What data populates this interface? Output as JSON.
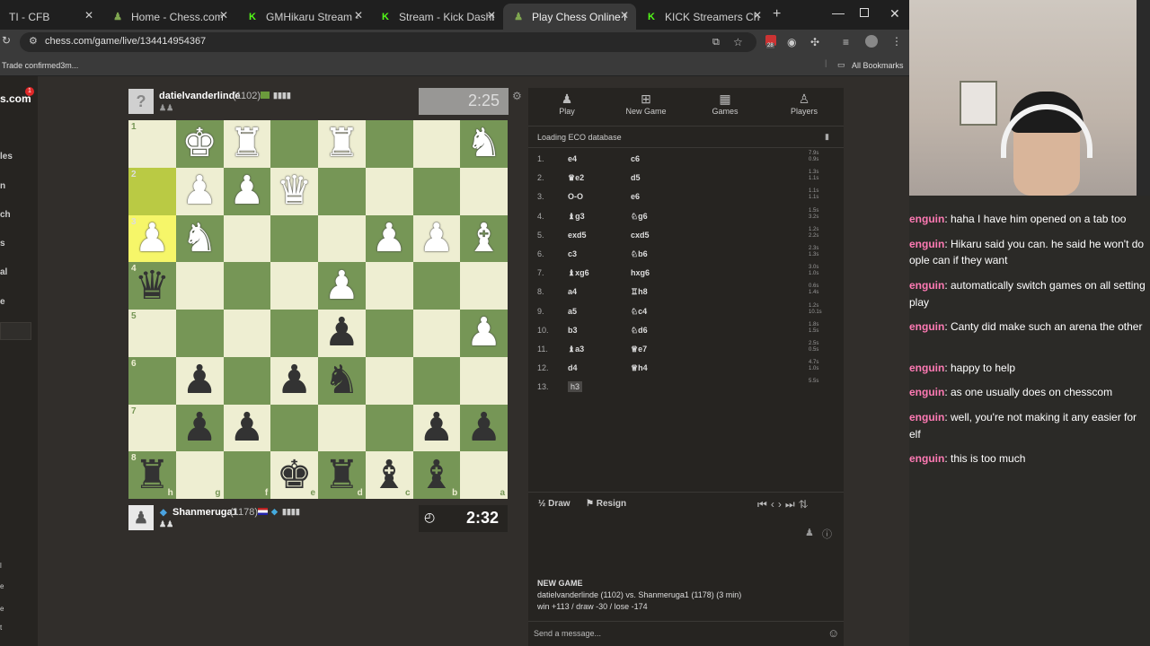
{
  "browser": {
    "tabs": [
      {
        "label": "TI - CFB",
        "icon": "generic-tab-icon"
      },
      {
        "label": "Home - Chess.com",
        "icon": "chess-com-icon"
      },
      {
        "label": "GMHikaru Stream - W",
        "icon": "kick-icon"
      },
      {
        "label": "Stream - Kick Dashboard",
        "icon": "kick-icon"
      },
      {
        "label": "Play Chess Online for",
        "icon": "chess-com-icon"
      },
      {
        "label": "KICK Streamers Chess Wo",
        "icon": "kick-icon"
      }
    ],
    "url": "chess.com/game/live/134414954367",
    "bookmark_left": "Trade confirmed3m...",
    "bookmark_right": "All Bookmarks",
    "extension_badge": "28"
  },
  "left_nav": {
    "logo": "s.com",
    "badge": "1",
    "items": [
      "les",
      "n",
      "ch",
      "s",
      "al",
      "e"
    ],
    "bottom_items": [
      "l",
      "e",
      "e",
      "t"
    ]
  },
  "top_player": {
    "name": "datielvanderlinde",
    "rating": "(1102)",
    "clock": "2:25"
  },
  "bottom_player": {
    "name": "Shanmeruga1",
    "rating": "(1178)",
    "clock": "2:32"
  },
  "board": {
    "ranks": [
      "1",
      "2",
      "3",
      "4",
      "5",
      "6",
      "7",
      "8"
    ],
    "files": [
      "h",
      "g",
      "f",
      "e",
      "d",
      "c",
      "b",
      "a"
    ],
    "rows": [
      [
        "",
        "wK",
        "wR",
        "",
        "wR",
        "",
        "",
        "wN"
      ],
      [
        "",
        "wP",
        "wP",
        "wQ",
        "",
        "",
        "",
        ""
      ],
      [
        "wP",
        "wN",
        "",
        "",
        "",
        "wP",
        "wP",
        "wB"
      ],
      [
        "bQ",
        "",
        "",
        "",
        "wP",
        "",
        "",
        ""
      ],
      [
        "",
        "",
        "",
        "",
        "bP",
        "",
        "",
        "wP"
      ],
      [
        "",
        "bP",
        "",
        "bP",
        "bN",
        "",
        "",
        ""
      ],
      [
        "",
        "bP",
        "bP",
        "",
        "",
        "",
        "bP",
        "bP"
      ],
      [
        "bR",
        "",
        "",
        "bK",
        "bR",
        "bB",
        "bB",
        ""
      ]
    ]
  },
  "panel": {
    "tabs": [
      {
        "label": "Play",
        "icon": "pawn-icon"
      },
      {
        "label": "New Game",
        "icon": "plus-icon"
      },
      {
        "label": "Games",
        "icon": "board-icon"
      },
      {
        "label": "Players",
        "icon": "players-icon"
      }
    ],
    "eco": "Loading ECO database",
    "moves": [
      {
        "n": "1.",
        "w": "e4",
        "b": "c6",
        "t1": "7.9s",
        "t2": "0.9s"
      },
      {
        "n": "2.",
        "w": "♛e2",
        "b": "d5",
        "t1": "1.3s",
        "t2": "1.1s"
      },
      {
        "n": "3.",
        "w": "O-O",
        "b": "e6",
        "t1": "1.1s",
        "t2": "1.1s"
      },
      {
        "n": "4.",
        "w": "♝g3",
        "b": "♘g6",
        "t1": "1.5s",
        "t2": "3.2s"
      },
      {
        "n": "5.",
        "w": "exd5",
        "b": "cxd5",
        "t1": "1.2s",
        "t2": "2.2s"
      },
      {
        "n": "6.",
        "w": "c3",
        "b": "♘b6",
        "t1": "2.3s",
        "t2": "1.3s"
      },
      {
        "n": "7.",
        "w": "♝xg6",
        "b": "hxg6",
        "t1": "3.0s",
        "t2": "1.0s"
      },
      {
        "n": "8.",
        "w": "a4",
        "b": "♖h8",
        "t1": "0.6s",
        "t2": "1.4s"
      },
      {
        "n": "9.",
        "w": "a5",
        "b": "♘c4",
        "t1": "1.2s",
        "t2": "10.1s"
      },
      {
        "n": "10.",
        "w": "b3",
        "b": "♘d6",
        "t1": "1.8s",
        "t2": "1.5s"
      },
      {
        "n": "11.",
        "w": "♝a3",
        "b": "♕e7",
        "t1": "2.5s",
        "t2": "0.5s"
      },
      {
        "n": "12.",
        "w": "d4",
        "b": "♕h4",
        "t1": "4.7s",
        "t2": "1.0s"
      },
      {
        "n": "13.",
        "w": "h3",
        "b": "",
        "t1": "5.5s",
        "t2": ""
      }
    ],
    "draw": "Draw",
    "resign": "Resign",
    "draw_icon": "½",
    "new_game_title": "NEW GAME",
    "game_line": "datielvanderlinde (1102) vs. Shanmeruga1 (1178) (3 min)",
    "score_line": "win +113 / draw -30 / lose -174",
    "message_placeholder": "Send a message..."
  },
  "chat": [
    {
      "user": "enguin",
      "text": ": haha I have him opened on a tab too"
    },
    {
      "user": "enguin",
      "text": ": Hikaru said you can. he said he won't do"
    },
    {
      "user": "",
      "text": "ople can if they want"
    },
    {
      "user": "enguin",
      "text": ": automatically switch games on all setting"
    },
    {
      "user": "",
      "text": "play"
    },
    {
      "user": "enguin",
      "text": ": Canty did make such an arena the other"
    },
    {
      "user": "enguin",
      "text": ": happy to help"
    },
    {
      "user": "enguin",
      "text": ": as one usually does on chesscom"
    },
    {
      "user": "enguin",
      "text": ": well, you're not making it any easier for"
    },
    {
      "user": "",
      "text": "elf"
    },
    {
      "user": "enguin",
      "text": ": this is too much"
    }
  ]
}
